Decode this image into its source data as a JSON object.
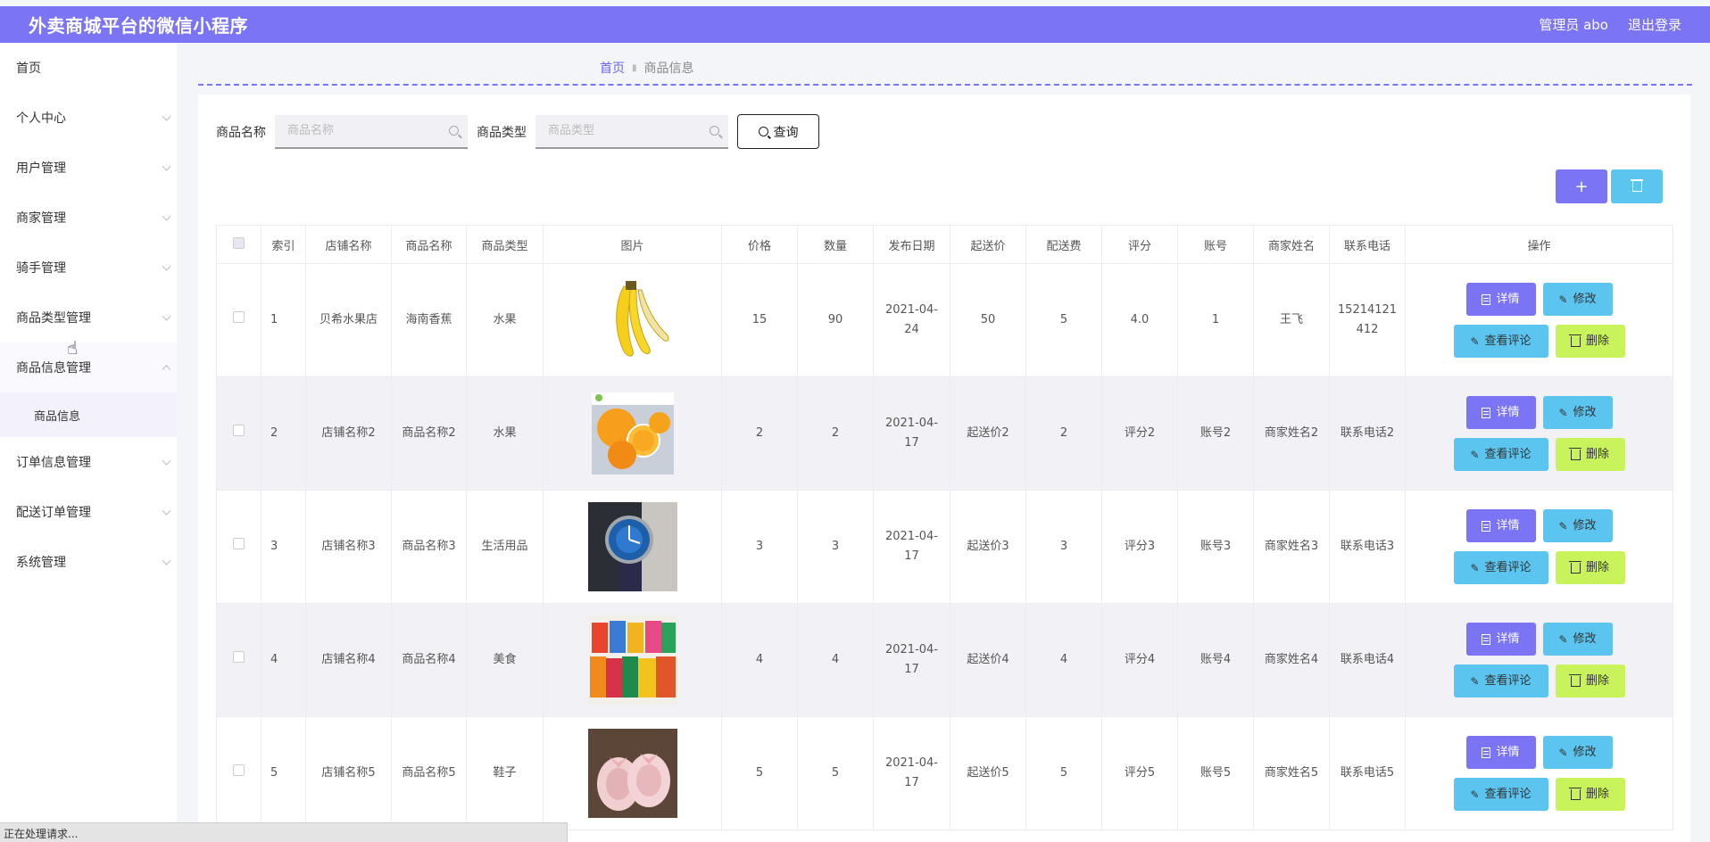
{
  "app": {
    "title": "外卖商城平台的微信小程序",
    "user": "管理员 abo",
    "logout": "退出登录"
  },
  "sidebar": {
    "items": [
      {
        "label": "首页"
      },
      {
        "label": "个人中心"
      },
      {
        "label": "用户管理"
      },
      {
        "label": "商家管理"
      },
      {
        "label": "骑手管理"
      },
      {
        "label": "商品类型管理"
      },
      {
        "label": "商品信息管理"
      },
      {
        "label": "订单信息管理"
      },
      {
        "label": "配送订单管理"
      },
      {
        "label": "系统管理"
      }
    ],
    "sub_item": "商品信息"
  },
  "breadcrumb": {
    "home": "首页",
    "current": "商品信息"
  },
  "search": {
    "name_label": "商品名称",
    "name_placeholder": "商品名称",
    "type_label": "商品类型",
    "type_placeholder": "商品类型",
    "query_label": "查询"
  },
  "toolbar": {
    "add_label": "+"
  },
  "table": {
    "headers": [
      "索引",
      "店铺名称",
      "商品名称",
      "商品类型",
      "图片",
      "价格",
      "数量",
      "发布日期",
      "起送价",
      "配送费",
      "评分",
      "账号",
      "商家姓名",
      "联系电话",
      "操作"
    ],
    "rows": [
      {
        "idx": "1",
        "shop": "贝希水果店",
        "name": "海南香蕉",
        "type": "水果",
        "img": "banana",
        "price": "15",
        "qty": "90",
        "date": "2021-04-24",
        "min": "50",
        "fee": "5",
        "score": "4.0",
        "acct": "1",
        "merchant": "王飞",
        "phone": "15214121412"
      },
      {
        "idx": "2",
        "shop": "店铺名称2",
        "name": "商品名称2",
        "type": "水果",
        "img": "orange",
        "price": "2",
        "qty": "2",
        "date": "2021-04-17",
        "min": "起送价2",
        "fee": "2",
        "score": "评分2",
        "acct": "账号2",
        "merchant": "商家姓名2",
        "phone": "联系电话2"
      },
      {
        "idx": "3",
        "shop": "店铺名称3",
        "name": "商品名称3",
        "type": "生活用品",
        "img": "watch",
        "price": "3",
        "qty": "3",
        "date": "2021-04-17",
        "min": "起送价3",
        "fee": "3",
        "score": "评分3",
        "acct": "账号3",
        "merchant": "商家姓名3",
        "phone": "联系电话3"
      },
      {
        "idx": "4",
        "shop": "店铺名称4",
        "name": "商品名称4",
        "type": "美食",
        "img": "snacks",
        "price": "4",
        "qty": "4",
        "date": "2021-04-17",
        "min": "起送价4",
        "fee": "4",
        "score": "评分4",
        "acct": "账号4",
        "merchant": "商家姓名4",
        "phone": "联系电话4"
      },
      {
        "idx": "5",
        "shop": "店铺名称5",
        "name": "商品名称5",
        "type": "鞋子",
        "img": "shoes",
        "price": "5",
        "qty": "5",
        "date": "2021-04-17",
        "min": "起送价5",
        "fee": "5",
        "score": "评分5",
        "acct": "账号5",
        "merchant": "商家姓名5",
        "phone": "联系电话5"
      }
    ],
    "actions": {
      "detail": "详情",
      "edit": "修改",
      "review": "查看评论",
      "delete": "删除"
    }
  },
  "status": {
    "text": "正在处理请求..."
  },
  "colors": {
    "primary": "#7b74f5",
    "info": "#5bc4ef",
    "lime": "#c9f35a"
  }
}
